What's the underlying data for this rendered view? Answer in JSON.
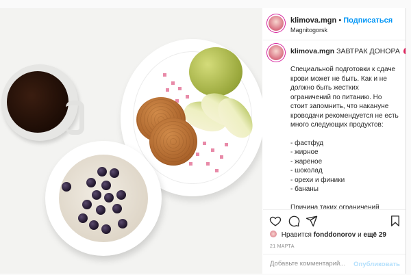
{
  "header": {
    "username": "klimova.mgn",
    "separator": "•",
    "follow_label": "Подписаться",
    "location": "Magnitogorsk"
  },
  "caption": {
    "username": "klimova.mgn",
    "title": "ЗАВТРАК ДОНОРА",
    "paragraph1": "Специальной подготовки к сдаче крови может не быть. Как и не должно быть жестких ограничений по питанию. Но стоит запомнить, что накануне кроводачи рекомендуется не есть много следующих продуктов:",
    "list": [
      "- фастфуд",
      "- жирное",
      "- жареное",
      "- шоколад",
      "- орехи и финики",
      "- бананы"
    ],
    "paragraph2": "Причина таких ограничений проста — употребление большого количества жиров, которые в"
  },
  "likes": {
    "prefix": "Нравится",
    "user": "fonddonorov",
    "suffix": "и",
    "more": "ещё 29"
  },
  "date": "21 МАРТА",
  "comment": {
    "placeholder": "Добавьте комментарий...",
    "publish_label": "Опубликовать"
  },
  "icons": {
    "like": "heart-icon",
    "comment": "comment-icon",
    "share": "paper-plane-icon",
    "save": "bookmark-icon",
    "title_emoji": "blood-drop-icon"
  },
  "colors": {
    "follow": "#0095f6",
    "publish_disabled": "#b2dffc",
    "drop": "#e0245e"
  }
}
